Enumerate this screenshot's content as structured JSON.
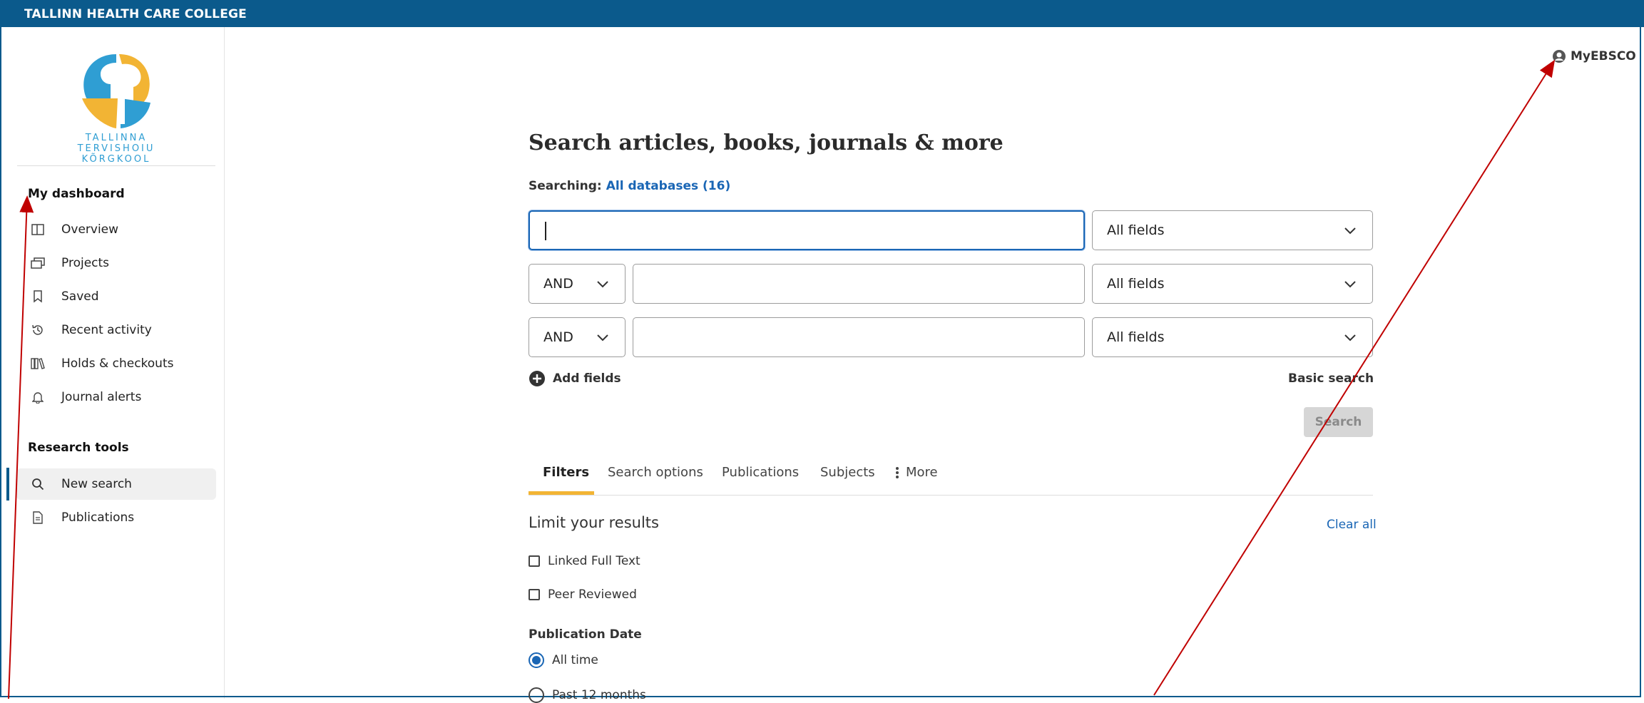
{
  "topbar": {
    "title": "TALLINN HEALTH CARE COLLEGE"
  },
  "logo": {
    "lines": [
      "TALLINNA",
      "TERVISHOIU",
      "KÕRGKOOL"
    ]
  },
  "sidebar": {
    "dashboard_heading": "My dashboard",
    "dashboard_items": [
      {
        "label": "Overview",
        "icon": "overview-icon"
      },
      {
        "label": "Projects",
        "icon": "projects-icon"
      },
      {
        "label": "Saved",
        "icon": "bookmark-icon"
      },
      {
        "label": "Recent activity",
        "icon": "history-icon"
      },
      {
        "label": "Holds & checkouts",
        "icon": "books-icon"
      },
      {
        "label": "Journal alerts",
        "icon": "bell-icon"
      }
    ],
    "tools_heading": "Research tools",
    "tools_items": [
      {
        "label": "New search",
        "icon": "search-icon",
        "active": true
      },
      {
        "label": "Publications",
        "icon": "document-icon"
      }
    ]
  },
  "header": {
    "account_label": "MyEBSCO"
  },
  "search": {
    "title": "Search articles, books, journals & more",
    "searching_label": "Searching:",
    "databases_link": "All databases (16)",
    "rows": [
      {
        "operator": "",
        "value": "",
        "field": "All fields"
      },
      {
        "operator": "AND",
        "value": "",
        "field": "All fields"
      },
      {
        "operator": "AND",
        "value": "",
        "field": "All fields"
      }
    ],
    "add_fields": "Add fields",
    "basic_search": "Basic search",
    "search_button": "Search"
  },
  "tabs": [
    {
      "label": "Filters",
      "active": true
    },
    {
      "label": "Search options"
    },
    {
      "label": "Publications"
    },
    {
      "label": "Subjects"
    },
    {
      "label": "More"
    }
  ],
  "filters": {
    "limit_heading": "Limit your results",
    "clear_all": "Clear all",
    "checkboxes": [
      {
        "label": "Linked Full Text",
        "checked": false
      },
      {
        "label": "Peer Reviewed",
        "checked": false
      }
    ],
    "pub_date_heading": "Publication Date",
    "pub_date_options": [
      {
        "label": "All time",
        "selected": true
      },
      {
        "label": "Past 12 months",
        "selected": false
      }
    ]
  },
  "colors": {
    "brand": "#0b5a8c",
    "link": "#1a66b5",
    "tab_accent": "#f2b434",
    "annotation_arrow": "#c00000"
  }
}
